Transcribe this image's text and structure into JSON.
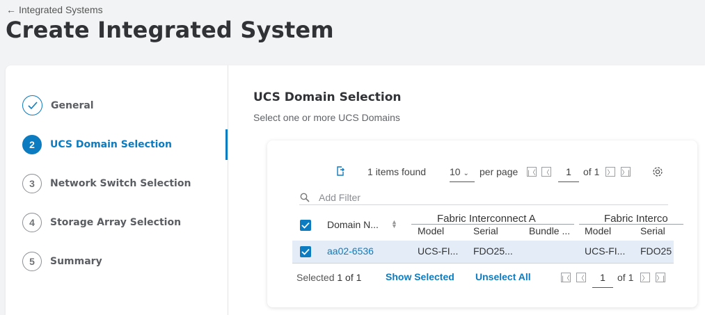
{
  "breadcrumb": {
    "arrow": "←",
    "label": "Integrated Systems"
  },
  "page_title": "Create Integrated System",
  "wizard": {
    "steps": [
      {
        "number": "",
        "label": "General",
        "state": "done"
      },
      {
        "number": "2",
        "label": "UCS Domain Selection",
        "state": "active"
      },
      {
        "number": "3",
        "label": "Network Switch Selection",
        "state": "pending"
      },
      {
        "number": "4",
        "label": "Storage Array Selection",
        "state": "pending"
      },
      {
        "number": "5",
        "label": "Summary",
        "state": "pending"
      }
    ]
  },
  "section": {
    "title": "UCS Domain Selection",
    "subtitle": "Select one or more UCS Domains"
  },
  "table": {
    "items_count": "1",
    "items_found_label": "items found",
    "per_page_value": "10",
    "per_page_label": "per page",
    "page_value": "1",
    "of_pages": "of 1",
    "filter_placeholder": "Add Filter",
    "group_headers": [
      "Fabric Interconnect A",
      "Fabric Interco"
    ],
    "columns": [
      "Domain N...",
      "Model",
      "Serial",
      "Bundle ...",
      "Model",
      "Serial"
    ],
    "rows": [
      {
        "domain": "aa02-6536",
        "fia_model": "UCS-FI...",
        "fia_serial": "FDO25...",
        "fia_bundle": "",
        "fib_model": "UCS-FI...",
        "fib_serial": "FDO25"
      }
    ],
    "footer": {
      "selected_label": "Selected",
      "selected_value": "1 of 1",
      "show_selected": "Show Selected",
      "unselect_all": "Unselect All",
      "page_value": "1",
      "of_pages": "of 1"
    }
  },
  "colors": {
    "accent": "#0d7bbf",
    "selected_row": "#e3ecf7"
  }
}
